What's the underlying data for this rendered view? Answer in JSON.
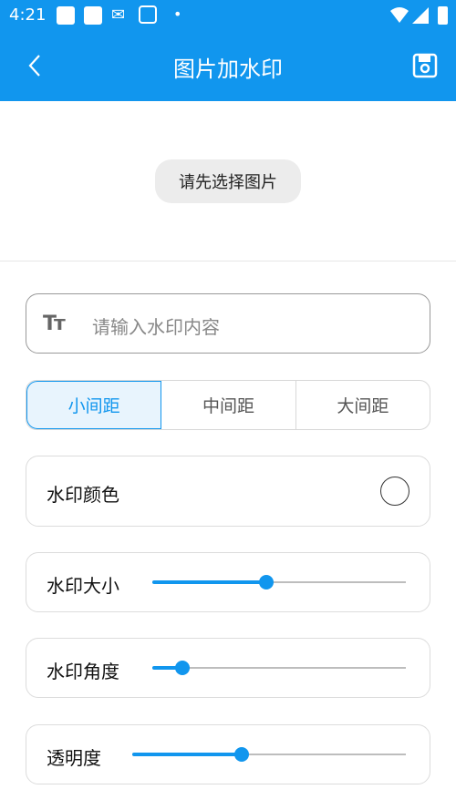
{
  "status_bar": {
    "time": "4:21"
  },
  "app_bar": {
    "title": "图片加水印"
  },
  "preview": {
    "pick_button": "请先选择图片"
  },
  "watermark_input": {
    "placeholder": "请输入水印内容",
    "icon_text": "Tт"
  },
  "spacing": {
    "options": [
      "小间距",
      "中间距",
      "大间距"
    ],
    "selected_index": 0
  },
  "color_row": {
    "label": "水印颜色"
  },
  "size_row": {
    "label": "水印大小",
    "value_fraction": 0.45
  },
  "angle_row": {
    "label": "水印角度",
    "value_fraction": 0.12
  },
  "opacity_row": {
    "label": "透明度",
    "value_fraction": 0.4
  },
  "colors": {
    "accent": "#1196ee"
  }
}
